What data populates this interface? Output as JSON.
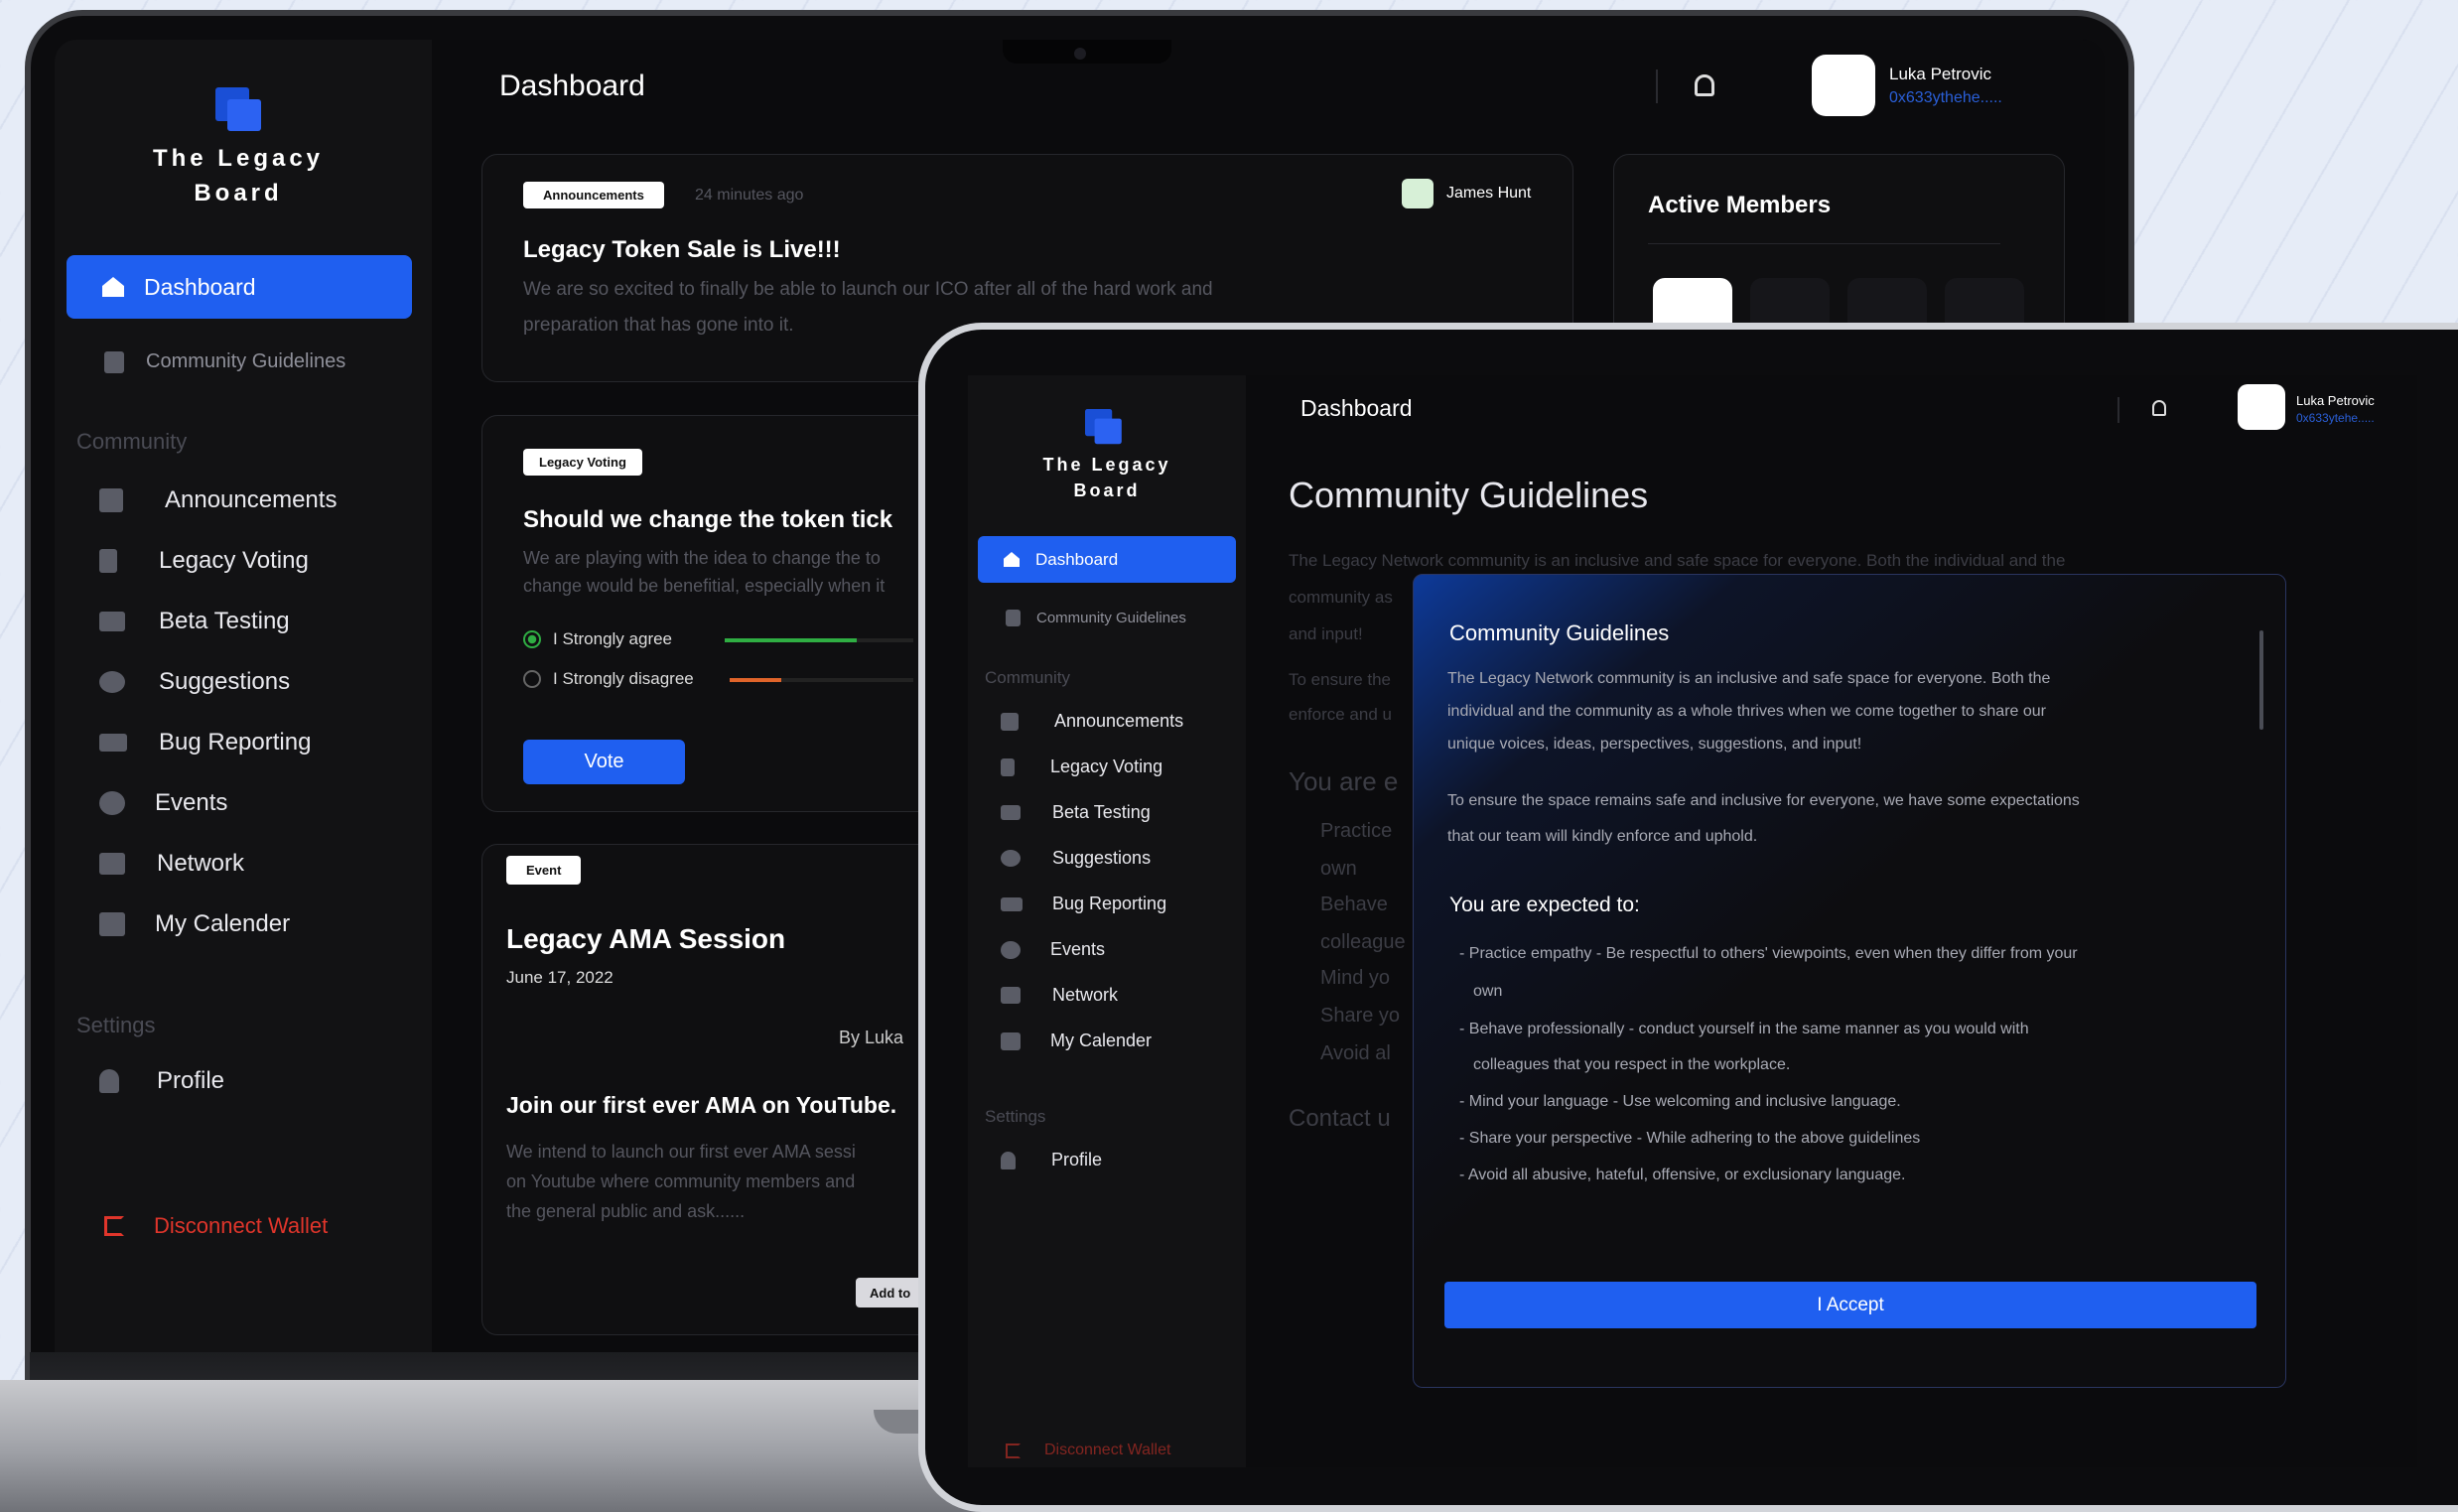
{
  "colors": {
    "accent": "#1f5ff0",
    "danger": "#e0352b",
    "background": "#0b0b0d",
    "card": "#0f0f11"
  },
  "brand": {
    "name_line1": "The Legacy",
    "name_line2": "Board"
  },
  "laptop": {
    "header": {
      "title": "Dashboard",
      "user_name": "Luka Petrovic",
      "user_wallet": "0x633ythehe.....",
      "bell_icon": "bell-icon"
    },
    "sidebar": {
      "dashboard": "Dashboard",
      "community_guidelines": "Community Guidelines",
      "community_label": "Community",
      "items": [
        {
          "label": "Announcements",
          "icon": "megaphone-icon"
        },
        {
          "label": "Legacy Voting",
          "icon": "vote-icon"
        },
        {
          "label": "Beta Testing",
          "icon": "flask-icon"
        },
        {
          "label": "Suggestions",
          "icon": "lightbulb-icon"
        },
        {
          "label": "Bug Reporting",
          "icon": "bug-icon"
        },
        {
          "label": "Events",
          "icon": "calendar-star-icon"
        },
        {
          "label": "Network",
          "icon": "network-icon"
        },
        {
          "label": "My Calender",
          "icon": "calendar-icon"
        }
      ],
      "settings_label": "Settings",
      "profile": "Profile",
      "disconnect": "Disconnect Wallet"
    },
    "announcement": {
      "tag": "Announcements",
      "time": "24 minutes ago",
      "author": "James Hunt",
      "title": "Legacy Token Sale is Live!!!",
      "body_line1": "We are so excited to finally be able to launch our ICO after all of the hard work and",
      "body_line2": "preparation that has gone into it."
    },
    "voting": {
      "tag": "Legacy Voting",
      "title": "Should we change the token tick",
      "body_line1": "We are playing with the idea to change the to",
      "body_line2": "change would be benefitial, especially when it",
      "options": [
        {
          "label": "I Strongly agree",
          "share": 0.7,
          "color": "#2fae43"
        },
        {
          "label": "I Strongly disagree",
          "share": 0.28,
          "color": "#e0642a"
        }
      ],
      "vote_button": "Vote"
    },
    "event": {
      "tag": "Event",
      "title": "Legacy AMA Session",
      "date": "June 17, 2022",
      "by": "By Luka",
      "subtitle": "Join our first ever AMA on YouTube.",
      "body_line1": "We intend to launch our first ever AMA sessi",
      "body_line2": "on Youtube where community members and",
      "body_line3": "the general public and ask......",
      "add_button": "Add to"
    },
    "active_members": {
      "title": "Active Members"
    }
  },
  "tablet": {
    "header": {
      "title": "Dashboard",
      "user_name": "Luka Petrovic",
      "user_wallet": "0x633ytehe.....",
      "bell_icon": "bell-icon"
    },
    "sidebar": {
      "dashboard": "Dashboard",
      "community_guidelines": "Community Guidelines",
      "community_label": "Community",
      "items": [
        {
          "label": "Announcements"
        },
        {
          "label": "Legacy Voting"
        },
        {
          "label": "Beta Testing"
        },
        {
          "label": "Suggestions"
        },
        {
          "label": "Bug Reporting"
        },
        {
          "label": "Events"
        },
        {
          "label": "Network"
        },
        {
          "label": "My Calender"
        }
      ],
      "settings_label": "Settings",
      "profile": "Profile",
      "disconnect": "Disconnect Wallet"
    },
    "page": {
      "title": "Community Guidelines",
      "intro_line1": "The Legacy Network community is an inclusive and safe space for everyone. Both the individual and the",
      "intro_line2": "community as",
      "intro_line3": "and input!",
      "ensure_line1": "To ensure the",
      "ensure_line2": "enforce and u",
      "expected": "You are e",
      "faded_items": [
        "Practice",
        "own",
        "Behave",
        "colleague",
        "Mind yo",
        "Share yo",
        "Avoid al"
      ],
      "contact": "Contact u"
    },
    "modal": {
      "title": "Community Guidelines",
      "p1_line1": "The Legacy Network community is an inclusive and safe space for everyone. Both the",
      "p1_line2": "individual and the community as a whole thrives when we come together to share our",
      "p1_line3": "unique voices, ideas, perspectives, suggestions, and input!",
      "p2_line1": "To ensure the space remains safe and inclusive for everyone, we have some expectations",
      "p2_line2": "that our team will kindly enforce and uphold.",
      "expected_title": "You are expected to:",
      "bullets": [
        "Practice empathy - Be respectful to others' viewpoints, even when they differ from your",
        "own",
        "Behave professionally - conduct yourself in the same manner as you would with",
        "colleagues that you respect in the workplace.",
        "Mind your language - Use welcoming and inclusive language.",
        "Share your perspective - While adhering to the above guidelines",
        "Avoid all abusive, hateful, offensive, or exclusionary language."
      ],
      "accept_button": "I Accept"
    }
  }
}
